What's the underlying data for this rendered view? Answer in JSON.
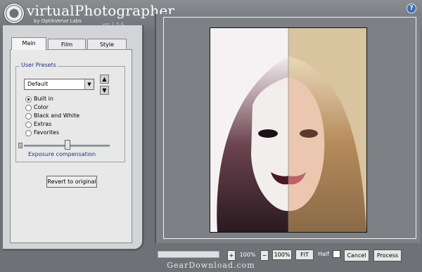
{
  "app": {
    "title": "virtualPhotographer",
    "subtitle": "by OptikVerve Labs",
    "version": "ver 1.5.6",
    "help_glyph": "?"
  },
  "tabs": [
    {
      "label": "Main",
      "active": true
    },
    {
      "label": "Film",
      "active": false
    },
    {
      "label": "Style",
      "active": false
    }
  ],
  "presets": {
    "group_label": "User Presets",
    "selected": "Default",
    "dropdown_glyph": "▼",
    "up_glyph": "▲",
    "down_glyph": "▼",
    "options": [
      {
        "label": "Built in",
        "checked": true
      },
      {
        "label": "Color",
        "checked": false
      },
      {
        "label": "Black and White",
        "checked": false
      },
      {
        "label": "Extras",
        "checked": false
      },
      {
        "label": "Favorites",
        "checked": false
      }
    ]
  },
  "exposure": {
    "label": "Exposure compensation",
    "level": 0.5
  },
  "buttons": {
    "revert": "Revert to original"
  },
  "toolbar": {
    "plus": "+",
    "minus": "−",
    "zoom_value": "100%",
    "zoom_100": "100%",
    "fit": "FIT",
    "half": "Half",
    "cancel": "Cancel",
    "process": "Process"
  },
  "footer": "GearDownload.com"
}
